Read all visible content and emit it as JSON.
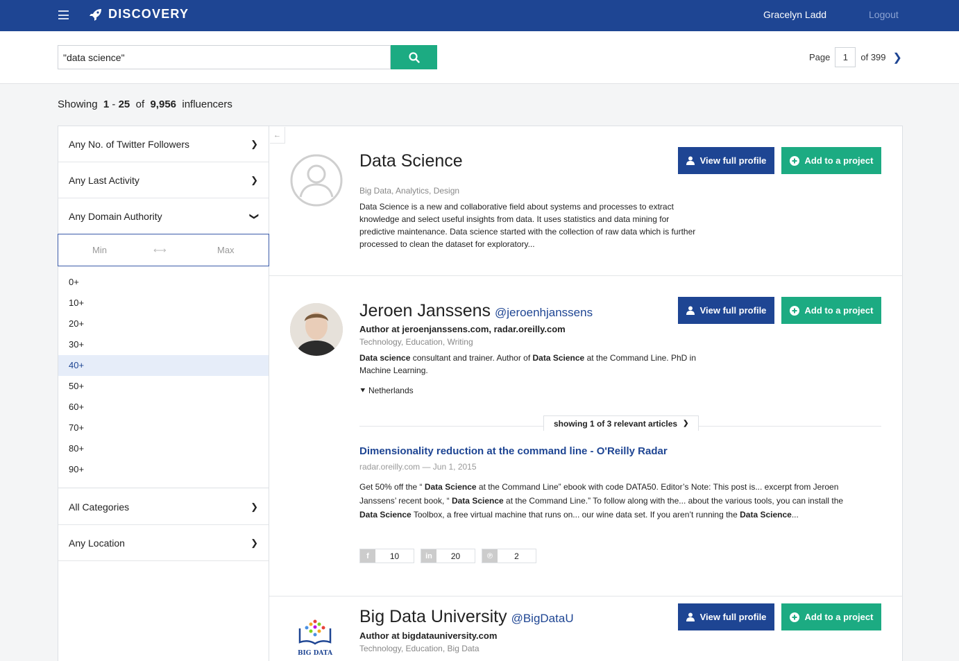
{
  "header": {
    "app_name": "DISCOVERY",
    "user_name": "Gracelyn Ladd",
    "logout_label": "Logout"
  },
  "search": {
    "query": "\"data science\"",
    "page_label": "Page",
    "page_current": "1",
    "page_total": "of 399"
  },
  "results_summary": {
    "prefix": "Showing",
    "range_start": "1",
    "separator": "-",
    "range_end": "25",
    "of": "of",
    "total": "9,956",
    "suffix": "influencers"
  },
  "filters": {
    "twitter_followers": "Any No. of Twitter Followers",
    "last_activity": "Any Last Activity",
    "domain_authority": "Any Domain Authority",
    "range_min_placeholder": "Min",
    "range_max_placeholder": "Max",
    "options": [
      "0+",
      "10+",
      "20+",
      "30+",
      "40+",
      "50+",
      "60+",
      "70+",
      "80+",
      "90+"
    ],
    "selected_option": "40+",
    "categories": "All Categories",
    "location": "Any Location"
  },
  "buttons": {
    "view_full_profile": "View full profile",
    "add_to_project": "Add to a project"
  },
  "results": [
    {
      "name": "Data Science",
      "tags": "Big Data, Analytics, Design",
      "description": "Data Science is a new and collaborative field about systems and processes to extract knowledge and select useful insights from data. It uses statistics and data mining for predictive maintenance. Data science started with the collection of raw data which is further processed to clean the dataset for exploratory..."
    },
    {
      "name": "Jeroen Janssens",
      "handle": "@jeroenhjanssens",
      "author": "Author at jeroenjanssens.com, radar.oreilly.com",
      "tags": "Technology, Education, Writing",
      "bio_1_strong": "Data science",
      "bio_2": " consultant and trainer. Author of ",
      "bio_3_strong": "Data Science",
      "bio_4": " at the Command Line. PhD in Machine Learning.",
      "location": "Netherlands",
      "articles_label": "showing 1 of 3 relevant articles",
      "article": {
        "title": "Dimensionality reduction at the command line - O'Reilly Radar",
        "meta": "radar.oreilly.com — Jun 1, 2015",
        "body_1": "Get 50% off the “ ",
        "body_2_strong": "Data Science",
        "body_3": " at the Command Line” ebook with code DATA50. Editor’s Note: This post is... excerpt from Jeroen Janssens’ recent book, “ ",
        "body_4_strong": "Data Science",
        "body_5": " at the Command Line.” To follow along with the... about the various tools, you can install the ",
        "body_6_strong": "Data Science",
        "body_7": " Toolbox, a free virtual machine that runs on... our wine data set. If you aren’t running the ",
        "body_8_strong": "Data Science",
        "body_9": "..."
      },
      "shares": {
        "facebook": "10",
        "linkedin": "20",
        "pinterest": "2"
      }
    },
    {
      "name": "Big Data University",
      "handle": "@BigDataU",
      "author": "Author at bigdatauniversity.com",
      "tags": "Technology, Education, Big Data"
    }
  ]
}
